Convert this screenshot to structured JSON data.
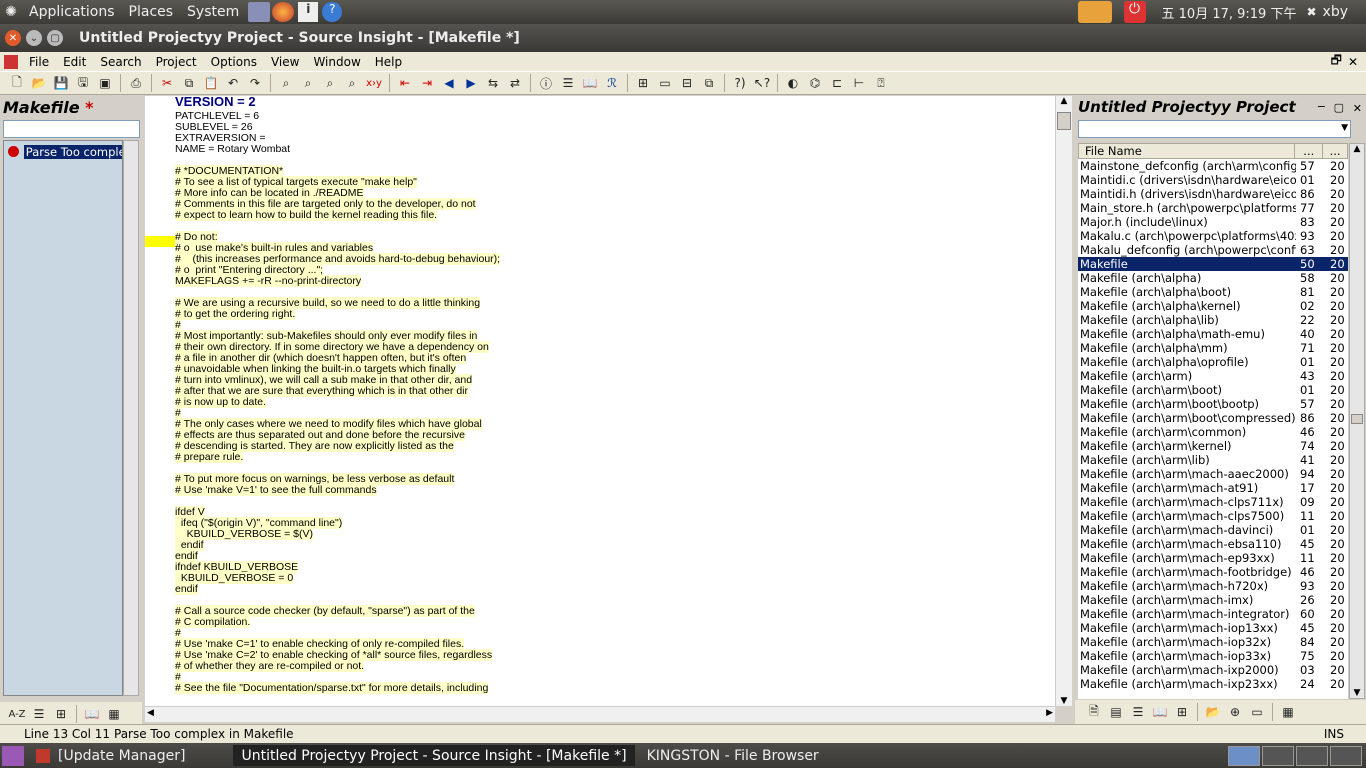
{
  "topbar": {
    "menus": [
      "Applications",
      "Places",
      "System"
    ],
    "clock": "五 10月 17,  9:19 下午",
    "user": "xby"
  },
  "window": {
    "title": "Untitled Projectyy Project - Source Insight - [Makefile *]"
  },
  "menubar": [
    "File",
    "Edit",
    "Search",
    "Project",
    "Options",
    "View",
    "Window",
    "Help"
  ],
  "left_panel": {
    "title": "Makefile",
    "modified_marker": "*",
    "item": "Parse Too comple"
  },
  "editor": {
    "lines": [
      {
        "t": "VERSION = 2",
        "c": "blu"
      },
      {
        "t": "PATCHLEVEL = 6",
        "c": ""
      },
      {
        "t": "SUBLEVEL = 26",
        "c": ""
      },
      {
        "t": "EXTRAVERSION =",
        "c": ""
      },
      {
        "t": "NAME = Rotary Wombat",
        "c": ""
      },
      {
        "t": "",
        "c": ""
      },
      {
        "t": "# *DOCUMENTATION*",
        "c": "hl"
      },
      {
        "t": "# To see a list of typical targets execute \"make help\"",
        "c": "hl"
      },
      {
        "t": "# More info can be located in ./README",
        "c": "hl"
      },
      {
        "t": "# Comments in this file are targeted only to the developer, do not",
        "c": "hl"
      },
      {
        "t": "# expect to learn how to build the kernel reading this file.",
        "c": "hl"
      },
      {
        "t": "",
        "c": ""
      },
      {
        "t": "# Do not:",
        "c": "hl"
      },
      {
        "t": "# o  use make's built-in rules and variables",
        "c": "hl"
      },
      {
        "t": "#    (this increases performance and avoids hard-to-debug behaviour);",
        "c": "hl"
      },
      {
        "t": "# o  print \"Entering directory ...\";",
        "c": "hl"
      },
      {
        "t": "MAKEFLAGS += -rR --no-print-directory",
        "c": "hl"
      },
      {
        "t": "",
        "c": ""
      },
      {
        "t": "# We are using a recursive build, so we need to do a little thinking",
        "c": "hl"
      },
      {
        "t": "# to get the ordering right.",
        "c": "hl"
      },
      {
        "t": "#",
        "c": "hl"
      },
      {
        "t": "# Most importantly: sub-Makefiles should only ever modify files in",
        "c": "hl"
      },
      {
        "t": "# their own directory. If in some directory we have a dependency on",
        "c": "hl"
      },
      {
        "t": "# a file in another dir (which doesn't happen often, but it's often",
        "c": "hl"
      },
      {
        "t": "# unavoidable when linking the built-in.o targets which finally",
        "c": "hl"
      },
      {
        "t": "# turn into vmlinux), we will call a sub make in that other dir, and",
        "c": "hl"
      },
      {
        "t": "# after that we are sure that everything which is in that other dir",
        "c": "hl"
      },
      {
        "t": "# is now up to date.",
        "c": "hl"
      },
      {
        "t": "#",
        "c": "hl"
      },
      {
        "t": "# The only cases where we need to modify files which have global",
        "c": "hl"
      },
      {
        "t": "# effects are thus separated out and done before the recursive",
        "c": "hl"
      },
      {
        "t": "# descending is started. They are now explicitly listed as the",
        "c": "hl"
      },
      {
        "t": "# prepare rule.",
        "c": "hl"
      },
      {
        "t": "",
        "c": ""
      },
      {
        "t": "# To put more focus on warnings, be less verbose as default",
        "c": "hl"
      },
      {
        "t": "# Use 'make V=1' to see the full commands",
        "c": "hl"
      },
      {
        "t": "",
        "c": ""
      },
      {
        "t": "ifdef V",
        "c": "hl"
      },
      {
        "t": "  ifeq (\"$(origin V)\", \"command line\")",
        "c": "hl"
      },
      {
        "t": "    KBUILD_VERBOSE = $(V)",
        "c": "hl"
      },
      {
        "t": "  endif",
        "c": "hl"
      },
      {
        "t": "endif",
        "c": "hl"
      },
      {
        "t": "ifndef KBUILD_VERBOSE",
        "c": "hl"
      },
      {
        "t": "  KBUILD_VERBOSE = 0",
        "c": "hl"
      },
      {
        "t": "endif",
        "c": "hl"
      },
      {
        "t": "",
        "c": ""
      },
      {
        "t": "# Call a source code checker (by default, \"sparse\") as part of the",
        "c": "hl"
      },
      {
        "t": "# C compilation.",
        "c": "hl"
      },
      {
        "t": "#",
        "c": "hl"
      },
      {
        "t": "# Use 'make C=1' to enable checking of only re-compiled files.",
        "c": "hl"
      },
      {
        "t": "# Use 'make C=2' to enable checking of *all* source files, regardless",
        "c": "hl"
      },
      {
        "t": "# of whether they are re-compiled or not.",
        "c": "hl"
      },
      {
        "t": "#",
        "c": "hl"
      },
      {
        "t": "# See the file \"Documentation/sparse.txt\" for more details, including",
        "c": "hl"
      }
    ]
  },
  "right_panel": {
    "title": "Untitled Projectyy Project",
    "header": {
      "name": "File Name",
      "col2": "...",
      "col3": "..."
    },
    "files": [
      [
        "Mainstone_defconfig (arch\\arm\\configs)",
        "57",
        "20"
      ],
      [
        "Maintidi.c (drivers\\isdn\\hardware\\eicon)",
        "01",
        "20"
      ],
      [
        "Maintidi.h (drivers\\isdn\\hardware\\eicon)",
        "86",
        "20"
      ],
      [
        "Main_store.h (arch\\powerpc\\platforms\\i",
        "77",
        "20"
      ],
      [
        "Major.h (include\\linux)",
        "83",
        "20"
      ],
      [
        "Makalu.c (arch\\powerpc\\platforms\\40x)",
        "93",
        "20"
      ],
      [
        "Makalu_defconfig (arch\\powerpc\\configs",
        "63",
        "20"
      ],
      [
        "Makefile",
        "50",
        "20"
      ],
      [
        "Makefile (arch\\alpha)",
        "58",
        "20"
      ],
      [
        "Makefile (arch\\alpha\\boot)",
        "81",
        "20"
      ],
      [
        "Makefile (arch\\alpha\\kernel)",
        "02",
        "20"
      ],
      [
        "Makefile (arch\\alpha\\lib)",
        "22",
        "20"
      ],
      [
        "Makefile (arch\\alpha\\math-emu)",
        "40",
        "20"
      ],
      [
        "Makefile (arch\\alpha\\mm)",
        "71",
        "20"
      ],
      [
        "Makefile (arch\\alpha\\oprofile)",
        "01",
        "20"
      ],
      [
        "Makefile (arch\\arm)",
        "43",
        "20"
      ],
      [
        "Makefile (arch\\arm\\boot)",
        "01",
        "20"
      ],
      [
        "Makefile (arch\\arm\\boot\\bootp)",
        "57",
        "20"
      ],
      [
        "Makefile (arch\\arm\\boot\\compressed)",
        "86",
        "20"
      ],
      [
        "Makefile (arch\\arm\\common)",
        "46",
        "20"
      ],
      [
        "Makefile (arch\\arm\\kernel)",
        "74",
        "20"
      ],
      [
        "Makefile (arch\\arm\\lib)",
        "41",
        "20"
      ],
      [
        "Makefile (arch\\arm\\mach-aaec2000)",
        "94",
        "20"
      ],
      [
        "Makefile (arch\\arm\\mach-at91)",
        "17",
        "20"
      ],
      [
        "Makefile (arch\\arm\\mach-clps711x)",
        "09",
        "20"
      ],
      [
        "Makefile (arch\\arm\\mach-clps7500)",
        "11",
        "20"
      ],
      [
        "Makefile (arch\\arm\\mach-davinci)",
        "01",
        "20"
      ],
      [
        "Makefile (arch\\arm\\mach-ebsa110)",
        "45",
        "20"
      ],
      [
        "Makefile (arch\\arm\\mach-ep93xx)",
        "11",
        "20"
      ],
      [
        "Makefile (arch\\arm\\mach-footbridge)",
        "46",
        "20"
      ],
      [
        "Makefile (arch\\arm\\mach-h720x)",
        "93",
        "20"
      ],
      [
        "Makefile (arch\\arm\\mach-imx)",
        "26",
        "20"
      ],
      [
        "Makefile (arch\\arm\\mach-integrator)",
        "60",
        "20"
      ],
      [
        "Makefile (arch\\arm\\mach-iop13xx)",
        "45",
        "20"
      ],
      [
        "Makefile (arch\\arm\\mach-iop32x)",
        "84",
        "20"
      ],
      [
        "Makefile (arch\\arm\\mach-iop33x)",
        "75",
        "20"
      ],
      [
        "Makefile (arch\\arm\\mach-ixp2000)",
        "03",
        "20"
      ],
      [
        "Makefile (arch\\arm\\mach-ixp23xx)",
        "24",
        "20"
      ]
    ],
    "selected_index": 7
  },
  "status": {
    "position": "Line 13  Col 11",
    "message": "Parse Too complex in Makefile",
    "mode": "INS"
  },
  "taskbar": {
    "tasks": [
      "[Update Manager]",
      "Untitled Projectyy Project - Source Insight - [Makefile *]",
      "KINGSTON - File Browser"
    ]
  }
}
